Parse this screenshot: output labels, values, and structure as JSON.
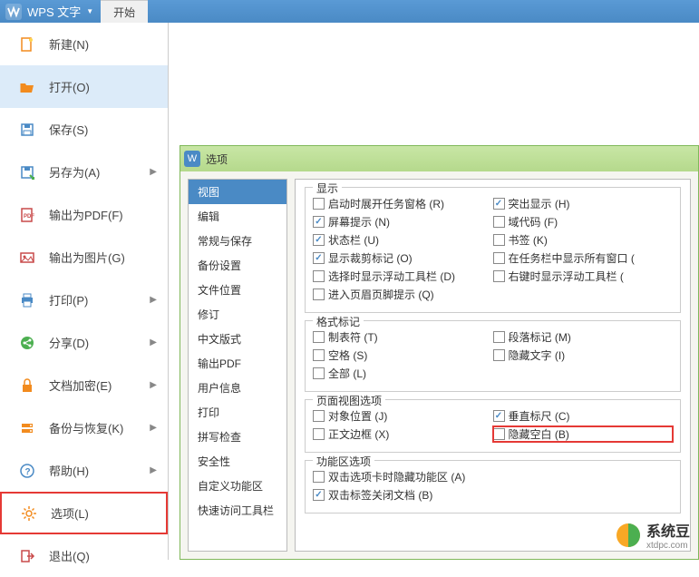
{
  "titlebar": {
    "title": "WPS 文字",
    "tab": "开始"
  },
  "filemenu": {
    "items": [
      {
        "label": "新建(N)",
        "icon": "new",
        "color": "#f28b1e",
        "arrow": false
      },
      {
        "label": "打开(O)",
        "icon": "open",
        "color": "#f28b1e",
        "arrow": false,
        "active": true
      },
      {
        "label": "保存(S)",
        "icon": "save",
        "color": "#4a8ac5",
        "arrow": false
      },
      {
        "label": "另存为(A)",
        "icon": "saveas",
        "color": "#4a8ac5",
        "arrow": true
      },
      {
        "label": "输出为PDF(F)",
        "icon": "pdf",
        "color": "#c94a4a",
        "arrow": false
      },
      {
        "label": "输出为图片(G)",
        "icon": "image",
        "color": "#c94a4a",
        "arrow": false
      },
      {
        "label": "打印(P)",
        "icon": "print",
        "color": "#4a8ac5",
        "arrow": true
      },
      {
        "label": "分享(D)",
        "icon": "share",
        "color": "#4caf50",
        "arrow": true
      },
      {
        "label": "文档加密(E)",
        "icon": "lock",
        "color": "#f28b1e",
        "arrow": true
      },
      {
        "label": "备份与恢复(K)",
        "icon": "backup",
        "color": "#f28b1e",
        "arrow": true
      },
      {
        "label": "帮助(H)",
        "icon": "help",
        "color": "#4a8ac5",
        "arrow": true
      },
      {
        "label": "选项(L)",
        "icon": "gear",
        "color": "#f28b1e",
        "arrow": false,
        "highlight": true
      },
      {
        "label": "退出(Q)",
        "icon": "exit",
        "color": "#c94a4a",
        "arrow": false
      }
    ]
  },
  "dialog": {
    "title": "选项",
    "sidebar": [
      "视图",
      "编辑",
      "常规与保存",
      "备份设置",
      "文件位置",
      "修订",
      "中文版式",
      "输出PDF",
      "用户信息",
      "打印",
      "拼写检查",
      "安全性",
      "自定义功能区",
      "快速访问工具栏"
    ],
    "selected_index": 0,
    "sections": {
      "display": {
        "legend": "显示",
        "left": [
          {
            "label": "启动时展开任务窗格 (R)",
            "checked": false
          },
          {
            "label": "屏幕提示 (N)",
            "checked": true
          },
          {
            "label": "状态栏 (U)",
            "checked": true
          },
          {
            "label": "显示裁剪标记 (O)",
            "checked": true
          },
          {
            "label": "选择时显示浮动工具栏 (D)",
            "checked": false
          },
          {
            "label": "进入页眉页脚提示 (Q)",
            "checked": false
          }
        ],
        "right": [
          {
            "label": "突出显示 (H)",
            "checked": true
          },
          {
            "label": "域代码 (F)",
            "checked": false
          },
          {
            "label": "书签 (K)",
            "checked": false
          },
          {
            "label": "在任务栏中显示所有窗口 (",
            "checked": false
          },
          {
            "label": "右键时显示浮动工具栏 (",
            "checked": false
          }
        ]
      },
      "format_marks": {
        "legend": "格式标记",
        "left": [
          {
            "label": "制表符 (T)",
            "checked": false
          },
          {
            "label": "空格 (S)",
            "checked": false
          },
          {
            "label": "全部 (L)",
            "checked": false
          }
        ],
        "right": [
          {
            "label": "段落标记 (M)",
            "checked": false
          },
          {
            "label": "隐藏文字 (I)",
            "checked": false
          }
        ]
      },
      "page_view": {
        "legend": "页面视图选项",
        "left": [
          {
            "label": "对象位置 (J)",
            "checked": false
          },
          {
            "label": "正文边框 (X)",
            "checked": false
          }
        ],
        "right": [
          {
            "label": "垂直标尺 (C)",
            "checked": true
          },
          {
            "label": "隐藏空白 (B)",
            "checked": false,
            "highlight": true
          }
        ]
      },
      "ribbon": {
        "legend": "功能区选项",
        "items": [
          {
            "label": "双击选项卡时隐藏功能区 (A)",
            "checked": false
          },
          {
            "label": "双击标签关闭文档 (B)",
            "checked": true
          }
        ]
      }
    }
  },
  "watermark": {
    "text": "系统豆",
    "sub": "xtdpc.com"
  }
}
